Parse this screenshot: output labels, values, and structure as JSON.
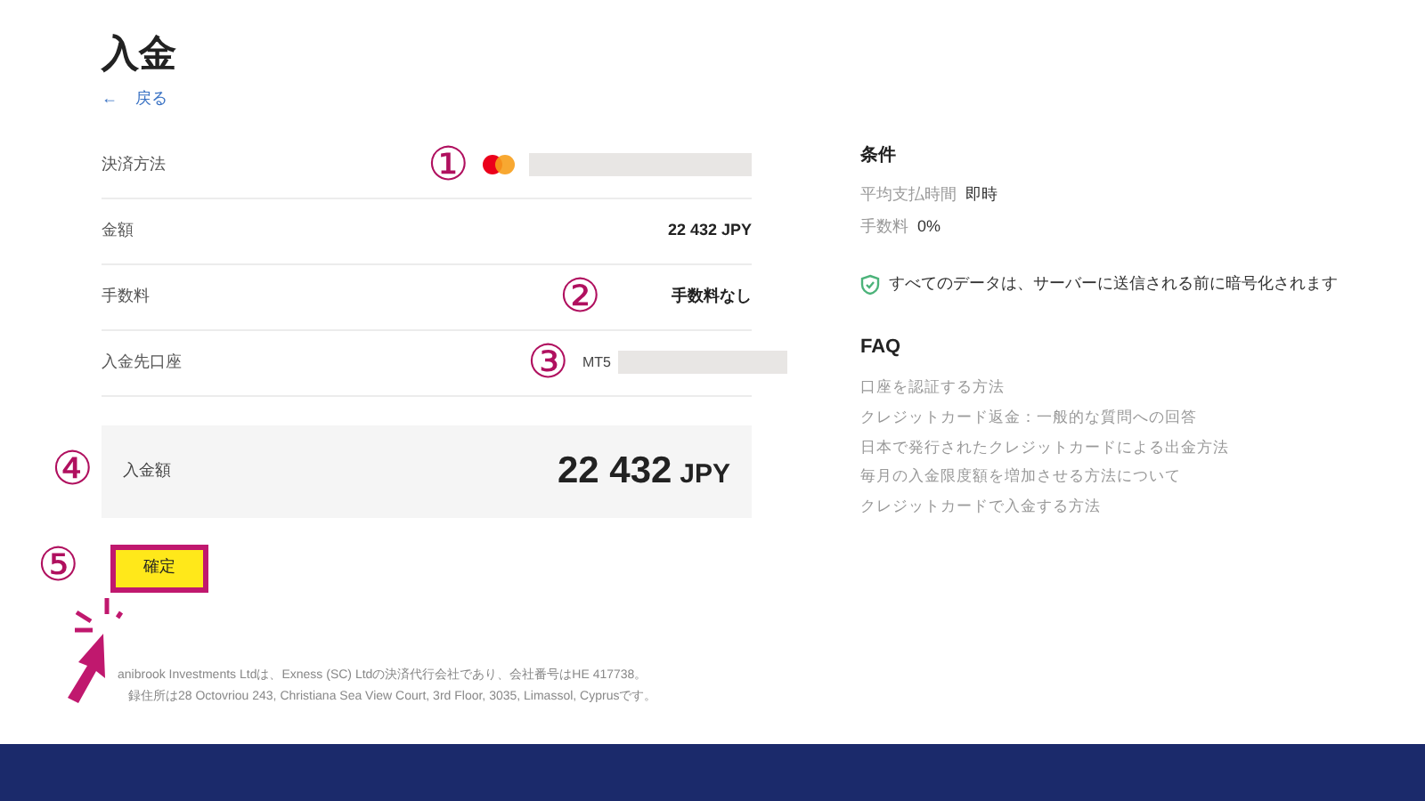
{
  "title": "入金",
  "back_link": {
    "arrow": "←",
    "label": "戻る"
  },
  "rows": [
    {
      "label": "決済方法",
      "marker": "①",
      "kind": "card"
    },
    {
      "label": "金額",
      "value": "22 432 JPY",
      "kind": "text"
    },
    {
      "label": "手数料",
      "marker": "②",
      "value": "手数料なし",
      "kind": "text"
    },
    {
      "label": "入金先口座",
      "marker": "③",
      "value": "MT5",
      "kind": "account"
    }
  ],
  "total": {
    "marker": "④",
    "label": "入金額",
    "amount": "22 432",
    "currency": "JPY"
  },
  "confirm_button": {
    "marker": "⑤",
    "label": "確定",
    "highlighted": true
  },
  "footer": [
    "anibrook Investments Ltdは、Exness (SC) Ltdの決済代行会社であり、会社番号はHE 417738。",
    "録住所は28 Octovriou 243, Christiana Sea View Court, 3rd Floor, 3035, Limassol, Cyprusです。"
  ],
  "conditions": {
    "title": "条件",
    "items": [
      {
        "label": "平均支払時間",
        "value": "即時"
      },
      {
        "label": "手数料",
        "value": "0%"
      }
    ],
    "security_note": "すべてのデータは、サーバーに送信される前に暗号化されます"
  },
  "faq": {
    "title": "FAQ",
    "links": [
      "口座を認証する方法",
      "クレジットカード返金：一般的な質問への回答",
      "日本で発行されたクレジットカードによる出金方法",
      "毎月の入金限度額を増加させる方法について",
      "クレジットカードで入金する方法"
    ]
  }
}
